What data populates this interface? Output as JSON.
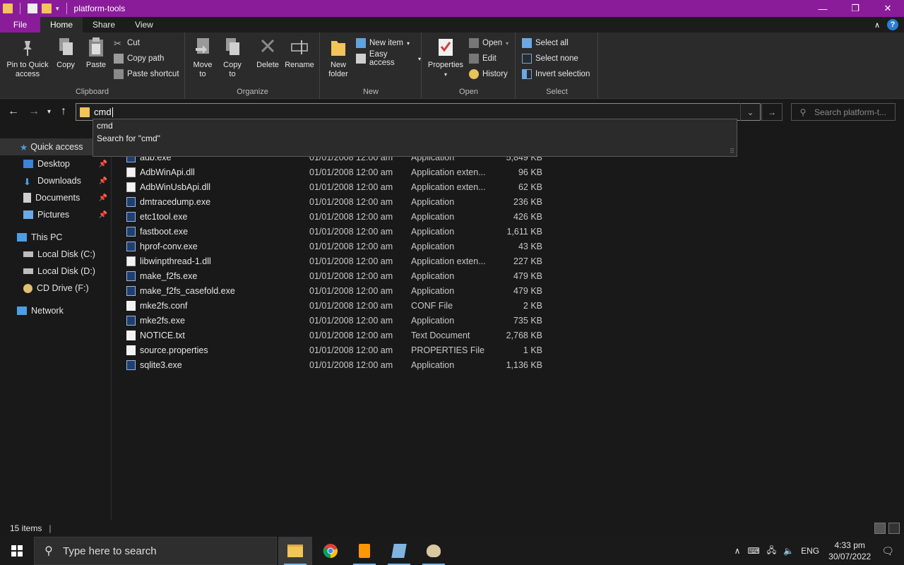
{
  "window": {
    "title": "platform-tools",
    "controls": {
      "minimize": "—",
      "maximize": "❐",
      "close": "✕"
    }
  },
  "tabs": [
    "File",
    "Home",
    "Share",
    "View"
  ],
  "ribbon": {
    "clipboard": {
      "label": "Clipboard",
      "pin": "Pin to Quick access",
      "copy": "Copy",
      "paste": "Paste",
      "cut": "Cut",
      "copy_path": "Copy path",
      "paste_shortcut": "Paste shortcut"
    },
    "organize": {
      "label": "Organize",
      "move_to": "Move to",
      "copy_to": "Copy to",
      "delete": "Delete",
      "rename": "Rename"
    },
    "new": {
      "label": "New",
      "new_folder": "New folder",
      "new_item": "New item",
      "easy_access": "Easy access"
    },
    "open": {
      "label": "Open",
      "properties": "Properties",
      "open": "Open",
      "edit": "Edit",
      "history": "History"
    },
    "select": {
      "label": "Select",
      "select_all": "Select all",
      "select_none": "Select none",
      "invert": "Invert selection"
    }
  },
  "address": {
    "value": "cmd",
    "search_placeholder": "Search platform-t..."
  },
  "suggestions": [
    "cmd",
    "Search for \"cmd\""
  ],
  "sidebar": {
    "quick_access": "Quick access",
    "items": [
      "Desktop",
      "Downloads",
      "Documents",
      "Pictures"
    ],
    "this_pc": "This PC",
    "drives": [
      "Local Disk (C:)",
      "Local Disk (D:)",
      "CD Drive (F:)"
    ],
    "network": "Network"
  },
  "files": [
    {
      "name": "adb.exe",
      "date": "01/01/2008 12:00 am",
      "type": "Application",
      "size": "5,849 KB",
      "kind": "exe"
    },
    {
      "name": "AdbWinApi.dll",
      "date": "01/01/2008 12:00 am",
      "type": "Application exten...",
      "size": "96 KB",
      "kind": "dll"
    },
    {
      "name": "AdbWinUsbApi.dll",
      "date": "01/01/2008 12:00 am",
      "type": "Application exten...",
      "size": "62 KB",
      "kind": "dll"
    },
    {
      "name": "dmtracedump.exe",
      "date": "01/01/2008 12:00 am",
      "type": "Application",
      "size": "236 KB",
      "kind": "exe"
    },
    {
      "name": "etc1tool.exe",
      "date": "01/01/2008 12:00 am",
      "type": "Application",
      "size": "426 KB",
      "kind": "exe"
    },
    {
      "name": "fastboot.exe",
      "date": "01/01/2008 12:00 am",
      "type": "Application",
      "size": "1,611 KB",
      "kind": "exe"
    },
    {
      "name": "hprof-conv.exe",
      "date": "01/01/2008 12:00 am",
      "type": "Application",
      "size": "43 KB",
      "kind": "exe"
    },
    {
      "name": "libwinpthread-1.dll",
      "date": "01/01/2008 12:00 am",
      "type": "Application exten...",
      "size": "227 KB",
      "kind": "dll"
    },
    {
      "name": "make_f2fs.exe",
      "date": "01/01/2008 12:00 am",
      "type": "Application",
      "size": "479 KB",
      "kind": "exe"
    },
    {
      "name": "make_f2fs_casefold.exe",
      "date": "01/01/2008 12:00 am",
      "type": "Application",
      "size": "479 KB",
      "kind": "exe"
    },
    {
      "name": "mke2fs.conf",
      "date": "01/01/2008 12:00 am",
      "type": "CONF File",
      "size": "2 KB",
      "kind": "doc"
    },
    {
      "name": "mke2fs.exe",
      "date": "01/01/2008 12:00 am",
      "type": "Application",
      "size": "735 KB",
      "kind": "exe"
    },
    {
      "name": "NOTICE.txt",
      "date": "01/01/2008 12:00 am",
      "type": "Text Document",
      "size": "2,768 KB",
      "kind": "doc"
    },
    {
      "name": "source.properties",
      "date": "01/01/2008 12:00 am",
      "type": "PROPERTIES File",
      "size": "1 KB",
      "kind": "doc"
    },
    {
      "name": "sqlite3.exe",
      "date": "01/01/2008 12:00 am",
      "type": "Application",
      "size": "1,136 KB",
      "kind": "exe"
    }
  ],
  "status": {
    "items": "15 items"
  },
  "taskbar": {
    "search_placeholder": "Type here to search",
    "lang": "ENG",
    "time": "4:33 pm",
    "date": "30/07/2022"
  },
  "colors": {
    "accent": "#8a1c9a",
    "folder": "#f3c45a",
    "background": "#191919",
    "ribbon": "#2b2b2b"
  }
}
